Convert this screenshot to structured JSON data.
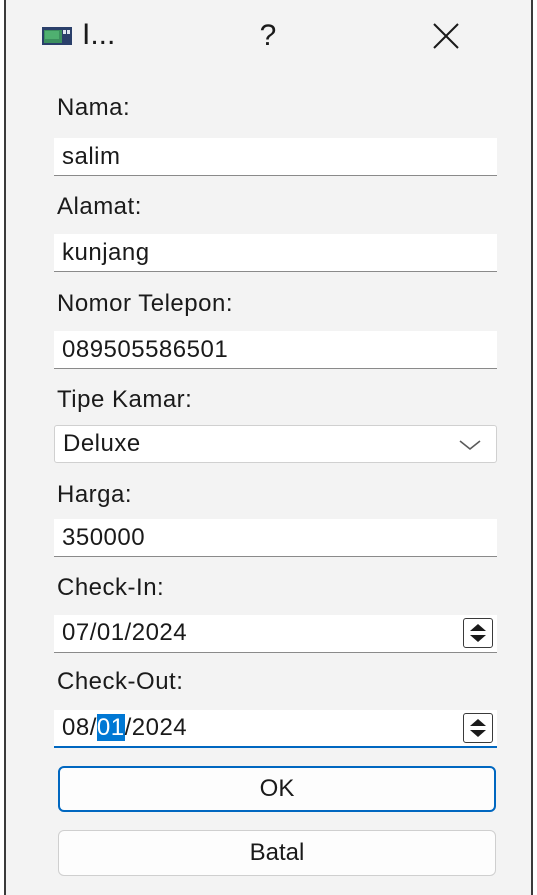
{
  "window": {
    "title": "I...",
    "help_label": "?"
  },
  "form": {
    "nama": {
      "label": "Nama:",
      "value": "salim"
    },
    "alamat": {
      "label": "Alamat:",
      "value": "kunjang"
    },
    "telepon": {
      "label": "Nomor Telepon:",
      "value": "089505586501"
    },
    "tipe_kamar": {
      "label": "Tipe Kamar:",
      "selected": "Deluxe"
    },
    "harga": {
      "label": "Harga:",
      "value": "350000"
    },
    "check_in": {
      "label": "Check-In:",
      "value": "07/01/2024"
    },
    "check_out": {
      "label": "Check-Out:",
      "value": "08/01/2024",
      "part_before": "08/",
      "part_selected": "01",
      "part_after": "/2024"
    }
  },
  "buttons": {
    "ok": "OK",
    "cancel": "Batal"
  },
  "colors": {
    "accent": "#0067c0",
    "selection": "#0078d4"
  },
  "icons": {
    "app": "app-window-icon",
    "close": "close-icon",
    "chevron": "chevron-down-icon",
    "spin": "spin-updown-icon"
  }
}
